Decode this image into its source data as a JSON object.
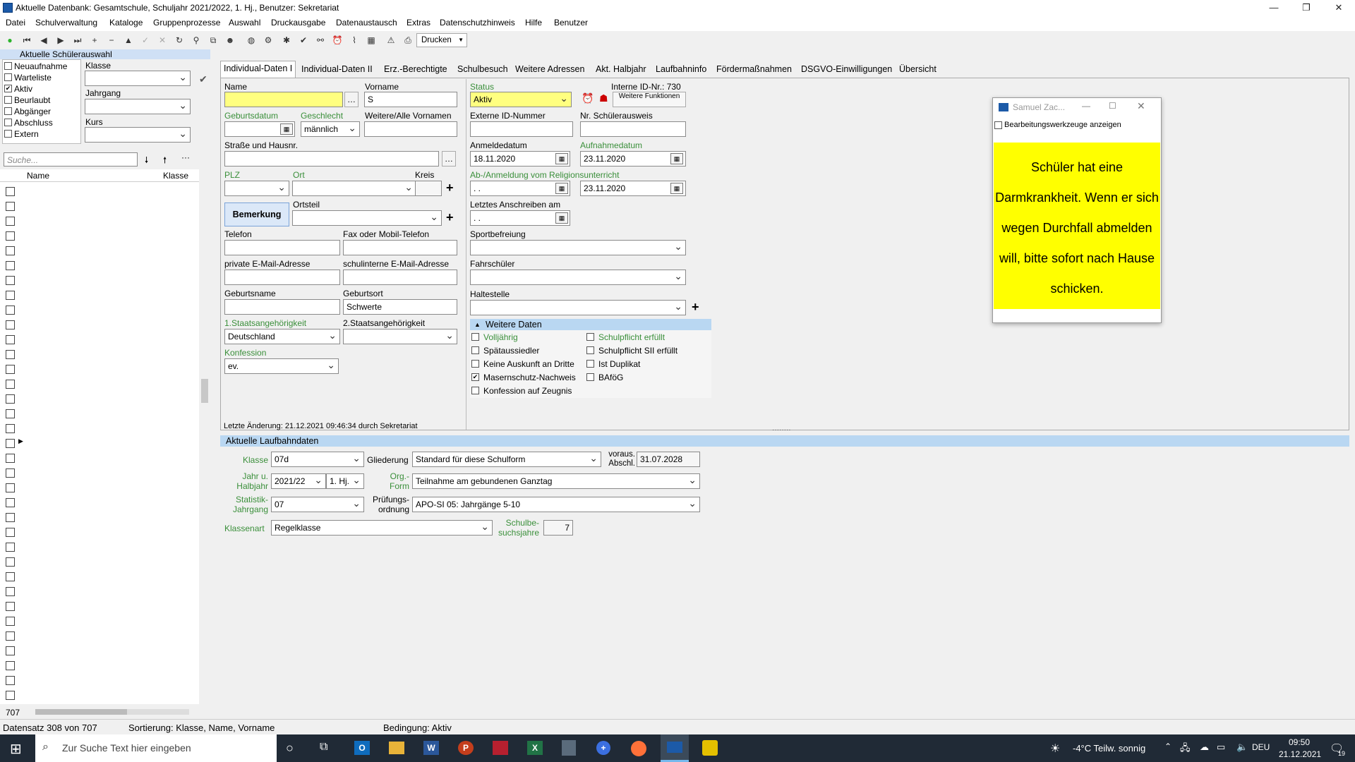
{
  "window": {
    "title": "Aktuelle Datenbank: Gesamtschule, Schuljahr 2021/2022, 1. Hj., Benutzer: Sekretariat"
  },
  "menu": [
    "Datei",
    "Schulverwaltung",
    "Kataloge",
    "Gruppenprozesse",
    "Auswahl",
    "Druckausgabe",
    "Datenaustausch",
    "Extras",
    "Datenschutzhinweis",
    "Hilfe",
    "Benutzer"
  ],
  "toolbar": {
    "print": "Drucken"
  },
  "sidebar": {
    "header": "Aktuelle Schülerauswahl",
    "filters": [
      {
        "label": "Neuaufnahme",
        "checked": false
      },
      {
        "label": "Warteliste",
        "checked": false
      },
      {
        "label": "Aktiv",
        "checked": true
      },
      {
        "label": "Beurlaubt",
        "checked": false
      },
      {
        "label": "Abgänger",
        "checked": false
      },
      {
        "label": "Abschluss",
        "checked": false
      },
      {
        "label": "Extern",
        "checked": false
      }
    ],
    "klasse_label": "Klasse",
    "jahrgang_label": "Jahrgang",
    "kurs_label": "Kurs",
    "search_placeholder": "Suche...",
    "col_name": "Name",
    "col_klasse": "Klasse",
    "count": "707"
  },
  "tabs": [
    "Individual-Daten I",
    "Individual-Daten II",
    "Erz.-Berechtigte",
    "Schulbesuch",
    "Weitere Adressen",
    "Akt. Halbjahr",
    "Laufbahninfo",
    "Fördermaßnahmen",
    "DSGVO-Einwilligungen",
    "Übersicht"
  ],
  "form": {
    "name_label": "Name",
    "vorname_label": "Vorname",
    "vorname_value": "S",
    "geburtsdatum_label": "Geburtsdatum",
    "geschlecht_label": "Geschlecht",
    "geschlecht_value": "männlich",
    "weitere_vornamen_label": "Weitere/Alle Vornamen",
    "strasse_label": "Straße und Hausnr.",
    "plz_label": "PLZ",
    "ort_label": "Ort",
    "kreis_label": "Kreis",
    "bemerkung_button": "Bemerkung",
    "ortsteil_label": "Ortsteil",
    "telefon_label": "Telefon",
    "fax_label": "Fax oder Mobil-Telefon",
    "email_label": "private E-Mail-Adresse",
    "schul_email_label": "schulinterne E-Mail-Adresse",
    "geburtsname_label": "Geburtsname",
    "geburtsort_label": "Geburtsort",
    "geburtsort_value": "Schwerte",
    "staat1_label": "1.Staatsangehörigkeit",
    "staat1_value": "Deutschland",
    "staat2_label": "2.Staatsangehörigkeit",
    "konfession_label": "Konfession",
    "konfession_value": "ev.",
    "status_label": "Status",
    "status_value": "Aktiv",
    "interne_id": "Interne ID-Nr.: 730",
    "weitere_funktionen": "Weitere Funktionen",
    "externe_id_label": "Externe ID-Nummer",
    "schuelerausweis_label": "Nr. Schülerausweis",
    "anmeldedatum_label": "Anmeldedatum",
    "anmeldedatum_value": "18.11.2020",
    "aufnahmedatum_label": "Aufnahmedatum",
    "aufnahmedatum_value": "23.11.2020",
    "religion_label": "Ab-/Anmeldung vom Religionsunterricht",
    "religion_value": " .  .",
    "religion_date2": "23.11.2020",
    "letztes_anschreiben_label": "Letztes Anschreiben am",
    "letztes_anschreiben_value": " .  .",
    "sportbefreiung_label": "Sportbefreiung",
    "fahrschueler_label": "Fahrschüler",
    "haltestelle_label": "Haltestelle",
    "weitere_daten_label": "Weitere Daten",
    "checks_left": [
      {
        "label": "Volljährig",
        "checked": false,
        "green": true
      },
      {
        "label": "Spätaussiedler",
        "checked": false
      },
      {
        "label": "Keine Auskunft an Dritte",
        "checked": false
      },
      {
        "label": "Masernschutz-Nachweis",
        "checked": true
      },
      {
        "label": "Konfession auf Zeugnis",
        "checked": false
      }
    ],
    "checks_right": [
      {
        "label": "Schulpflicht erfüllt",
        "checked": false,
        "green": true
      },
      {
        "label": "Schulpflicht SII erfüllt",
        "checked": false
      },
      {
        "label": "Ist Duplikat",
        "checked": false
      },
      {
        "label": "BAföG",
        "checked": false
      }
    ],
    "last_change": "Letzte Änderung: 21.12.2021 09:46:34 durch Sekretariat"
  },
  "laufbahn": {
    "header": "Aktuelle Laufbahndaten",
    "klasse_label": "Klasse",
    "klasse_value": "07d",
    "gliederung_label": "Gliederung",
    "gliederung_value": "Standard für diese Schulform",
    "abschl_label": "voraus. Abschl.",
    "abschl_value": "31.07.2028",
    "jahr_label": "Jahr u. Halbjahr",
    "jahr_value": "2021/22",
    "halbjahr_value": "1. Hj.",
    "orgform_label": "Org.-Form",
    "orgform_value": "Teilnahme am gebundenen Ganztag",
    "statistik_label": "Statistik-Jahrgang",
    "statistik_value": "07",
    "pruefung_label": "Prüfungs-ordnung",
    "pruefung_value": "APO-SI 05: Jahrgänge 5-10",
    "klassenart_label": "Klassenart",
    "klassenart_value": "Regelklasse",
    "schulbesuch_label": "Schulbe-suchsjahre",
    "schulbesuch_value": "7"
  },
  "popup": {
    "title": "Samuel Zac...",
    "checkbox": "Bearbeitungswerkzeuge anzeigen",
    "note": "Schüler hat eine Darmkrankheit. Wenn er sich wegen Durchfall abmelden will, bitte sofort nach Hause schicken."
  },
  "status": {
    "datensatz": "Datensatz 308 von 707",
    "sortierung": "Sortierung: Klasse, Name, Vorname",
    "bedingung": "Bedingung: Aktiv"
  },
  "taskbar": {
    "search": "Zur Suche Text hier eingeben",
    "weather": "-4°C  Teilw. sonnig",
    "lang": "DEU",
    "time": "09:50",
    "date": "21.12.2021",
    "notif": "19"
  }
}
